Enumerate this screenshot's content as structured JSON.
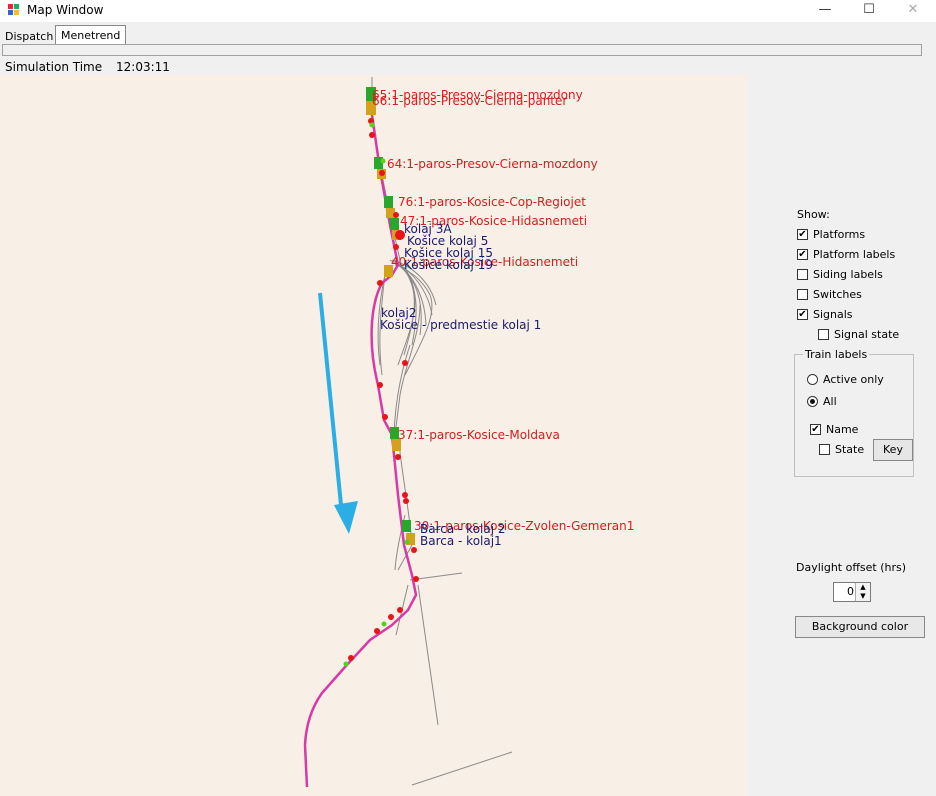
{
  "window": {
    "title": "Map Window",
    "minimize_glyph": "—",
    "maximize_glyph": "☐",
    "close_glyph": "✕"
  },
  "tabs": [
    "Dispatch",
    "Menetrend"
  ],
  "simulation": {
    "label": "Simulation Time",
    "time": "12:03:11"
  },
  "map": {
    "train_labels": [
      "65:1-paros-Presov-Cierna-mozdony",
      "66:1-paros-Presov-Cierna-panter",
      "64:1-paros-Presov-Cierna-mozdony",
      "76:1-paros-Kosice-Cop-Regiojet",
      "47:1-paros-Kosice-Hidasnemeti",
      "40:1-paros-Kosice-Hidasnemeti",
      "37:1-paros-Kosice-Moldava",
      "30:1-paros-Kosice-Zvolen-Gemeran1"
    ],
    "platform_labels": [
      "kolaj 3A",
      "Košice kolaj 5",
      "Košice kolaj 15",
      "Košice kolaj 19",
      "kolaj2",
      "Košice - predmestie kolaj 1",
      "Barca - kolaj 2",
      "Barca - kolaj1"
    ]
  },
  "panel": {
    "show_label": "Show:",
    "options": [
      {
        "label": "Platforms",
        "checked": true
      },
      {
        "label": "Platform labels",
        "checked": true
      },
      {
        "label": "Siding labels",
        "checked": false
      },
      {
        "label": "Switches",
        "checked": false
      },
      {
        "label": "Signals",
        "checked": true
      },
      {
        "label": "Signal state",
        "checked": false
      }
    ],
    "train_labels_group": {
      "title": "Train labels",
      "radios": [
        {
          "label": "Active only",
          "selected": false
        },
        {
          "label": "All",
          "selected": true
        }
      ],
      "name_label": "Name",
      "name_checked": true,
      "state_label": "State",
      "state_checked": false,
      "key_button": "Key"
    },
    "daylight_label": "Daylight offset (hrs)",
    "daylight_value": "0",
    "background_button": "Background color"
  },
  "colors": {
    "map_background": "#f8efe6",
    "route_line": "#d63aa6",
    "signal_red": "#e8141c",
    "signal_green": "#54d21c",
    "train_label": "#d21f1f",
    "platform_label": "#1a1a6e",
    "arrow": "#2aaee4"
  },
  "icons": [
    "app-icon",
    "minimize-icon",
    "maximize-icon",
    "close-icon",
    "spinner-arrows-icon"
  ]
}
